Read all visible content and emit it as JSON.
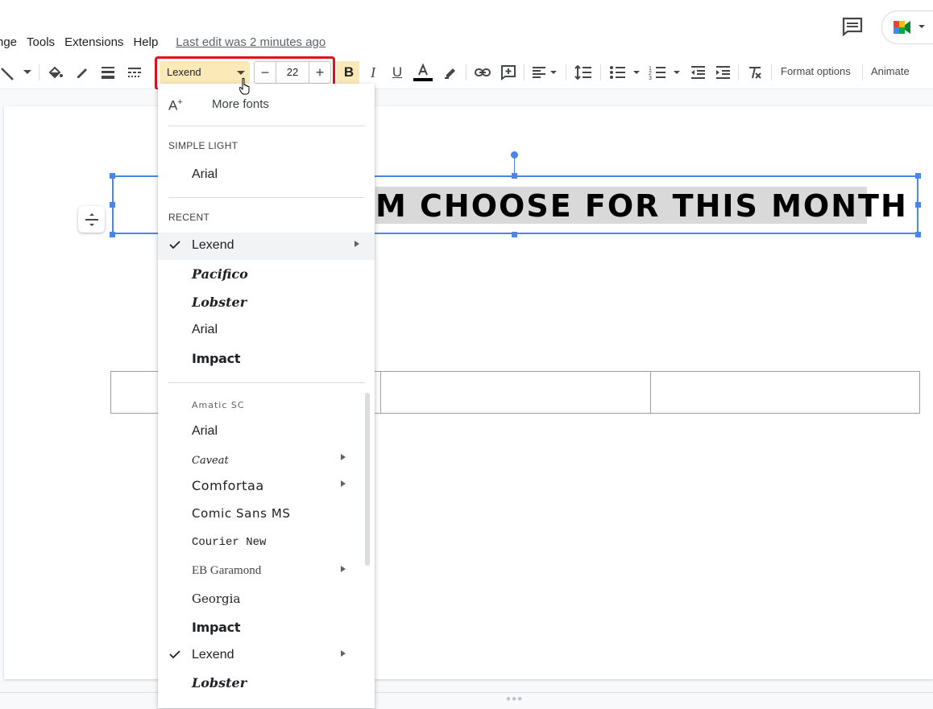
{
  "menu": {
    "items": [
      "nge",
      "Tools",
      "Extensions",
      "Help"
    ],
    "last_edit": "Last edit was 2 minutes ago"
  },
  "toolbar": {
    "font_name": "Lexend",
    "font_size": "22",
    "size_minus": "−",
    "size_plus": "+",
    "format_options": "Format options",
    "animate": "Animate"
  },
  "slide": {
    "title_text": "M CHOOSE FOR THIS MONTH"
  },
  "font_menu": {
    "more_fonts": "More fonts",
    "section_theme": "SIMPLE LIGHT",
    "theme_fonts": [
      "Arial"
    ],
    "section_recent": "RECENT",
    "recent_fonts": [
      "Lexend",
      "Pacifico",
      "Lobster",
      "Arial",
      "Impact"
    ],
    "all_fonts": [
      "Amatic SC",
      "Arial",
      "Caveat",
      "Comfortaa",
      "Comic Sans MS",
      "Courier New",
      "EB Garamond",
      "Georgia",
      "Impact",
      "Lexend",
      "Lobster"
    ],
    "selected_font": "Lexend"
  },
  "colors": {
    "accent_highlight": "#fbe9b7",
    "selection_blue": "#4a86e8",
    "callout_red": "#e0101b"
  }
}
